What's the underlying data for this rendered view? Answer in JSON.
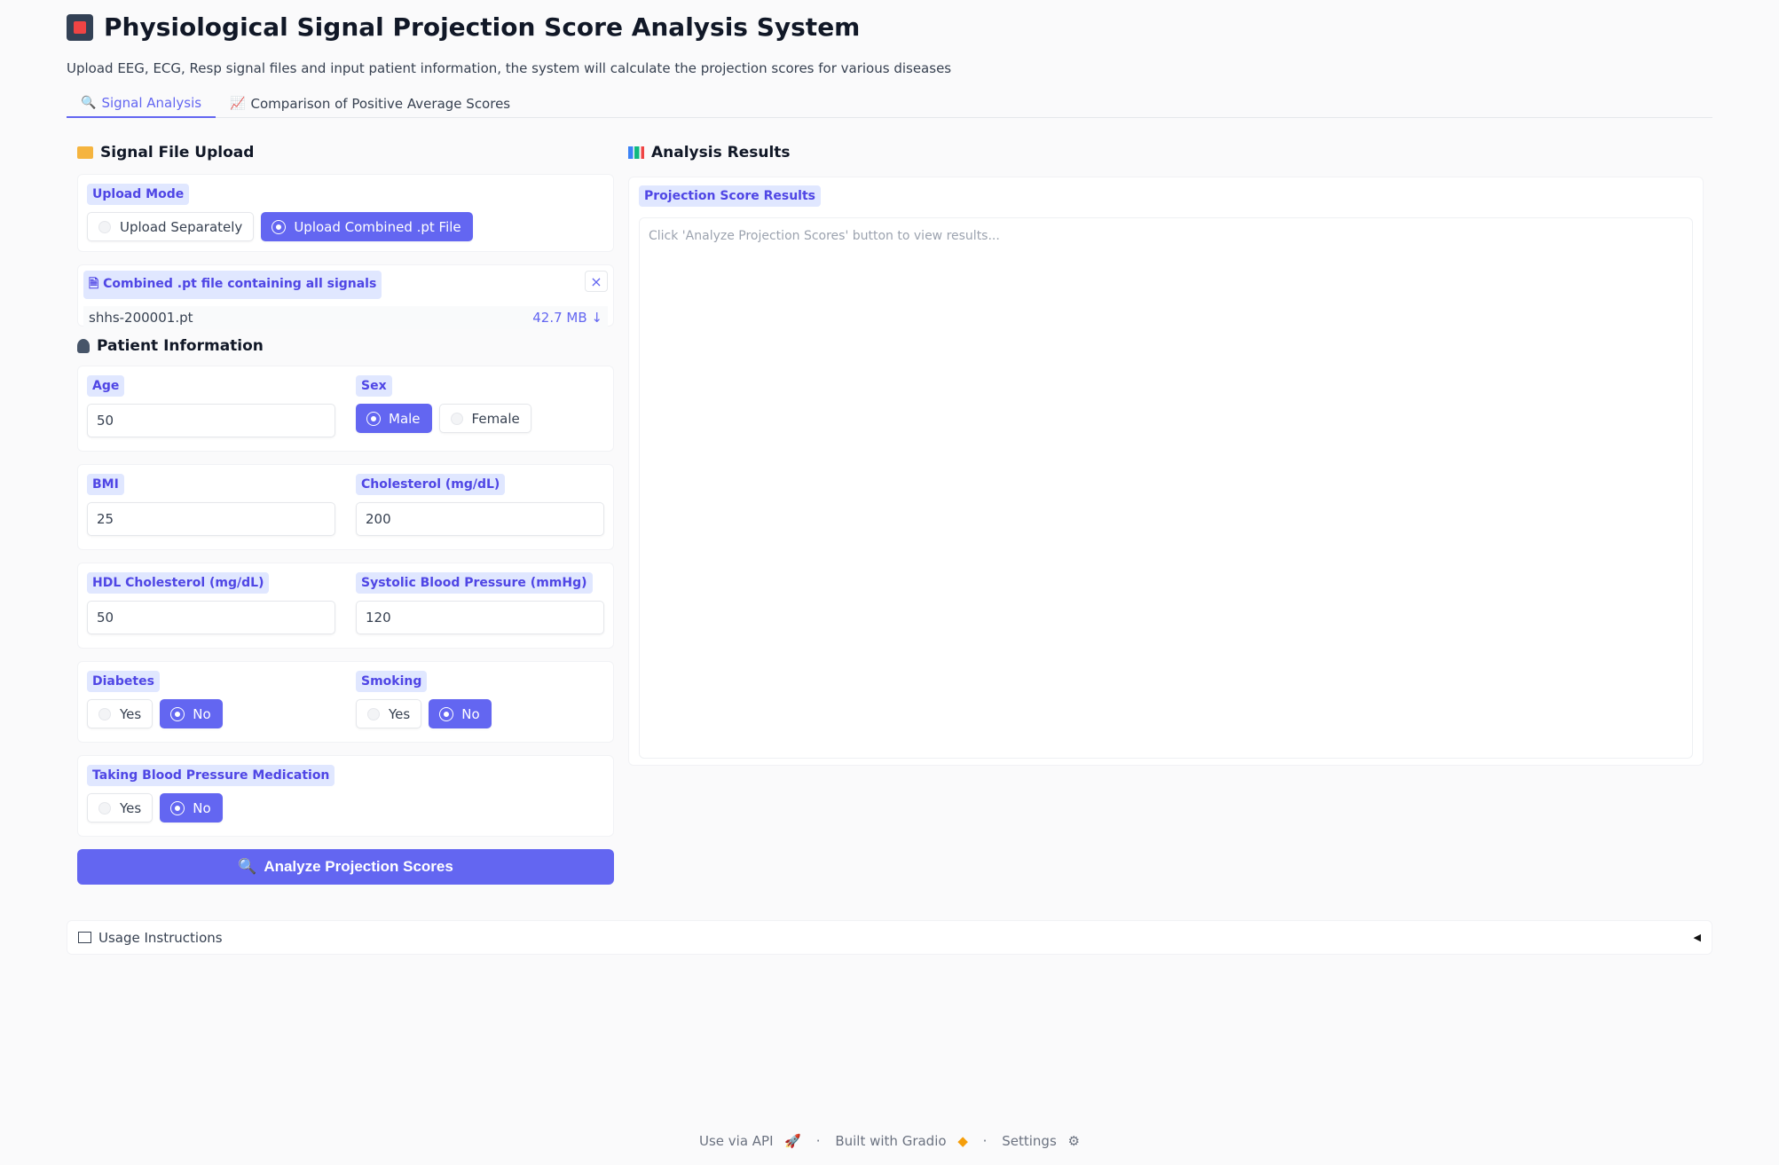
{
  "header": {
    "title": "Physiological Signal Projection Score Analysis System",
    "subtitle": "Upload EEG, ECG, Resp signal files and input patient information, the system will calculate the projection scores for various diseases"
  },
  "tabs": [
    {
      "label": "Signal Analysis",
      "icon": "magnifier-icon",
      "active": true
    },
    {
      "label": "Comparison of Positive Average Scores",
      "icon": "chart-up-icon",
      "active": false
    }
  ],
  "upload": {
    "section_title": "Signal File Upload",
    "mode_label": "Upload Mode",
    "mode_options": [
      "Upload Separately",
      "Upload Combined .pt File"
    ],
    "mode_selected": "Upload Combined .pt File",
    "file_label": "Combined .pt file containing all signals",
    "file_name": "shhs-200001.pt",
    "file_size": "42.7 MB ↓"
  },
  "patient": {
    "section_title": "Patient Information",
    "age_label": "Age",
    "age_value": "50",
    "sex_label": "Sex",
    "sex_options": [
      "Male",
      "Female"
    ],
    "sex_selected": "Male",
    "bmi_label": "BMI",
    "bmi_value": "25",
    "chol_label": "Cholesterol (mg/dL)",
    "chol_value": "200",
    "hdl_label": "HDL Cholesterol (mg/dL)",
    "hdl_value": "50",
    "sbp_label": "Systolic Blood Pressure (mmHg)",
    "sbp_value": "120",
    "diabetes_label": "Diabetes",
    "diabetes_selected": "No",
    "smoking_label": "Smoking",
    "smoking_selected": "No",
    "bpmed_label": "Taking Blood Pressure Medication",
    "bpmed_selected": "No",
    "yes": "Yes",
    "no": "No"
  },
  "analyze_button": "Analyze Projection Scores",
  "results": {
    "section_title": "Analysis Results",
    "box_label": "Projection Score Results",
    "placeholder": "Click 'Analyze Projection Scores' button to view results..."
  },
  "usage": {
    "label": "Usage Instructions"
  },
  "footer": {
    "api": "Use via API",
    "built": "Built with Gradio",
    "settings": "Settings"
  },
  "colors": {
    "accent": "#6366f1",
    "label_bg": "#e0e7ff",
    "background": "#fafafb"
  }
}
